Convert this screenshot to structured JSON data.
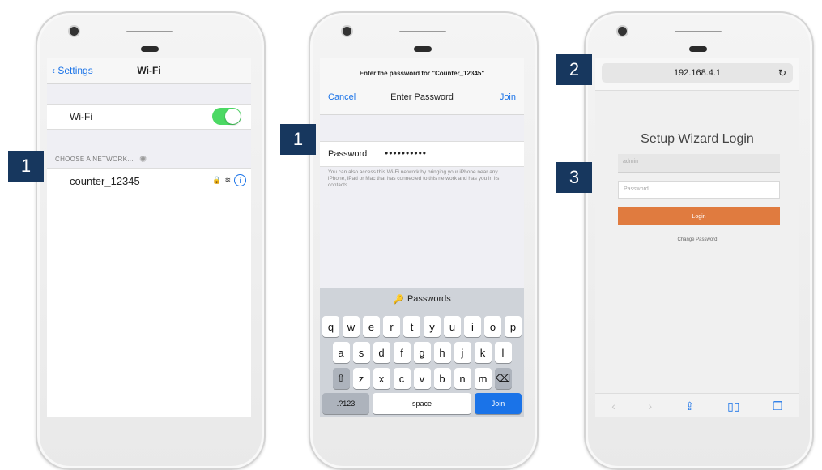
{
  "phone1": {
    "badge": "1",
    "back_label": "Settings",
    "title": "Wi-Fi",
    "wifi_label": "Wi-Fi",
    "section_label": "CHOOSE A NETWORK...",
    "network_name": "counter_12345",
    "toggle_on_color": "#4cd964"
  },
  "phone2": {
    "badge": "1",
    "prompt": "Enter the password for \"Counter_12345\"",
    "cancel_label": "Cancel",
    "title": "Enter Password",
    "join_label": "Join",
    "password_label": "Password",
    "password_value": "••••••••••",
    "help_text": "You can also access this Wi-Fi network by bringing your iPhone near any iPhone, iPad or Mac that has connected to this network and has you in its contacts.",
    "keyboard": {
      "bar_label": "Passwords",
      "row1": [
        "q",
        "w",
        "e",
        "r",
        "t",
        "y",
        "u",
        "i",
        "o",
        "p"
      ],
      "row2": [
        "a",
        "s",
        "d",
        "f",
        "g",
        "h",
        "j",
        "k",
        "l"
      ],
      "row3": [
        "z",
        "x",
        "c",
        "v",
        "b",
        "n",
        "m"
      ],
      "shift_icon": "⇧",
      "delete_icon": "⌫",
      "numbers_label": ".?123",
      "space_label": "space",
      "join_label": "Join"
    }
  },
  "phone3": {
    "badge_url": "2",
    "badge_password": "3",
    "url": "192.168.4.1",
    "reload_icon": "↻",
    "title": "Setup Wizard Login",
    "username_value": "admin",
    "password_placeholder": "Password",
    "login_label": "Login",
    "change_password_label": "Change Password"
  },
  "colors": {
    "badge_bg": "#17375e",
    "ios_blue": "#1a73e8",
    "login_orange": "#e07b3f"
  }
}
